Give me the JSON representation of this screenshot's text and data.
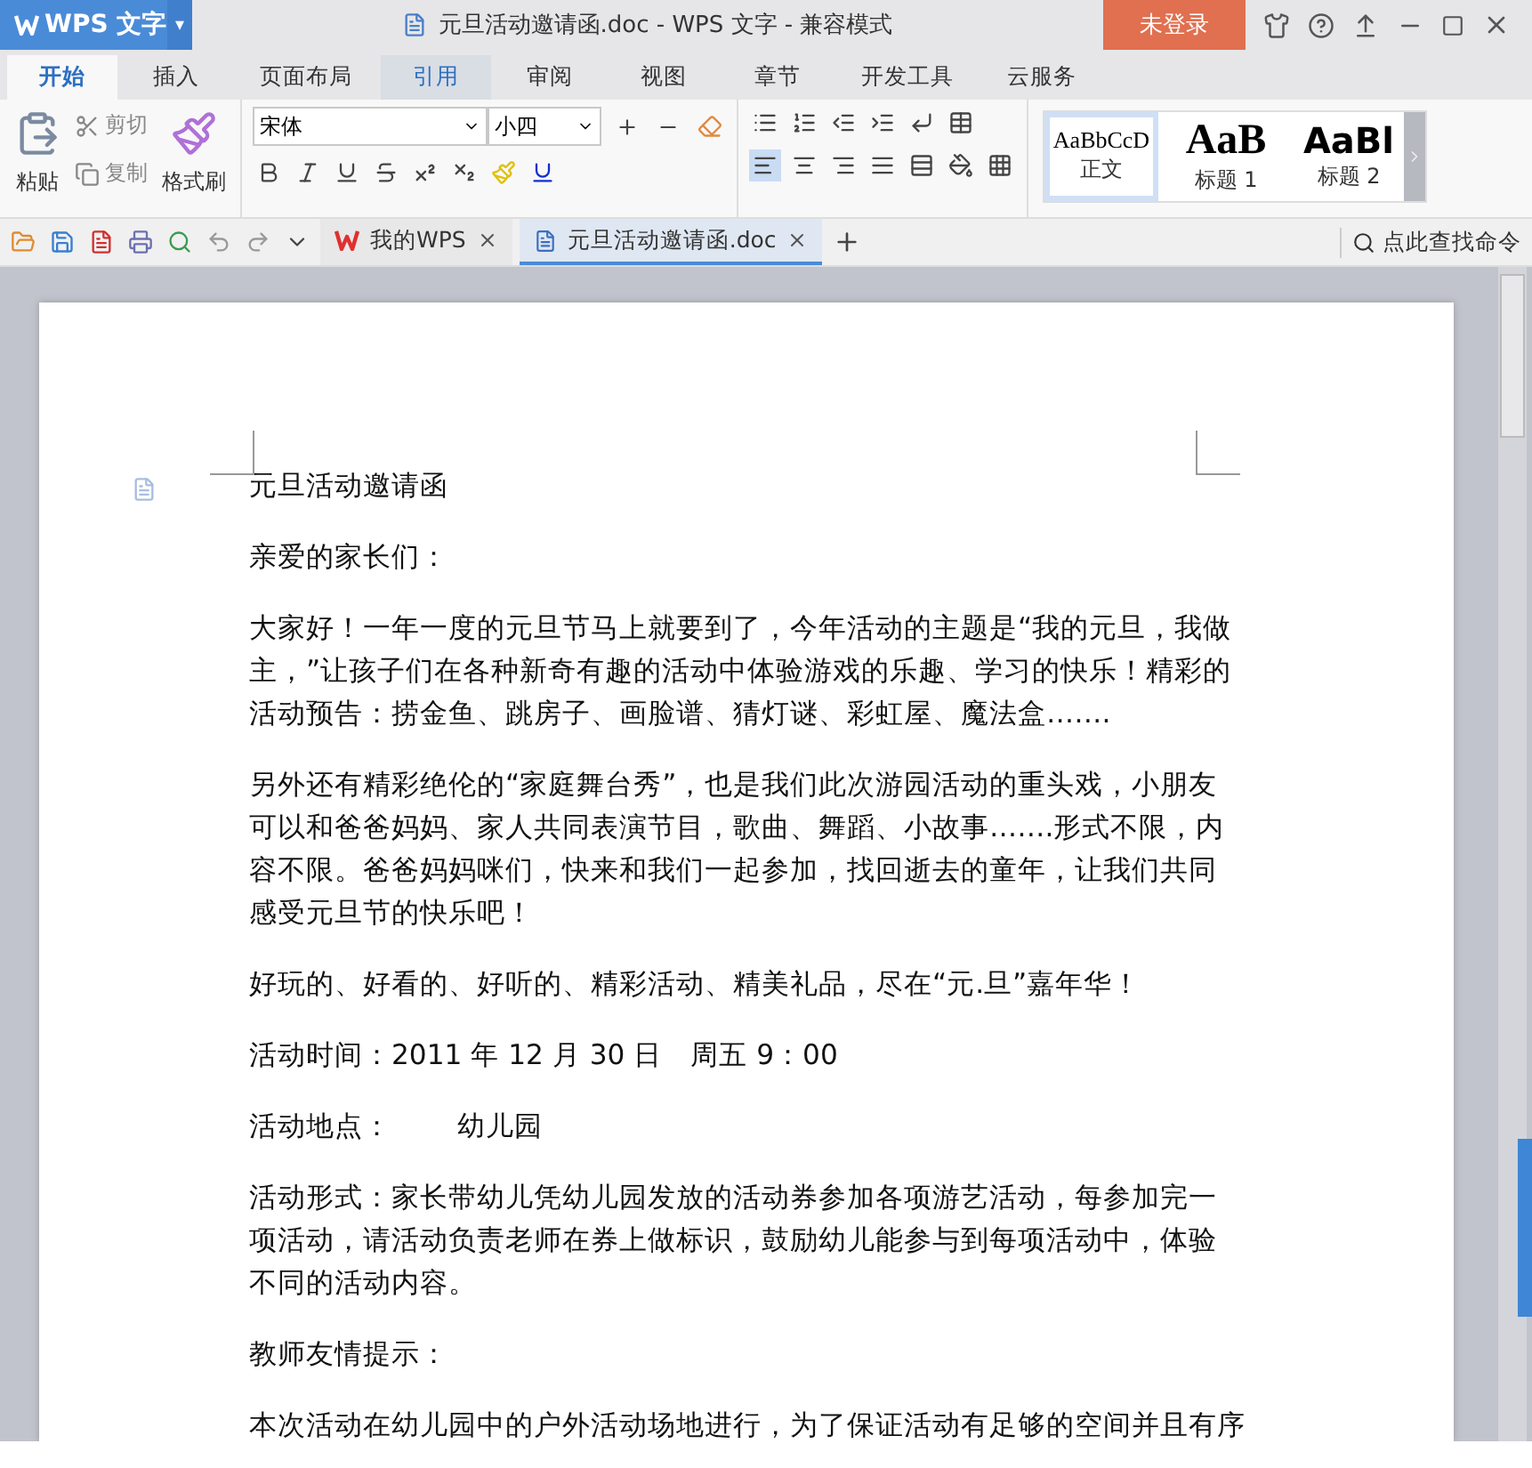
{
  "app_button": {
    "label": "WPS 文字",
    "caret": "▾"
  },
  "window": {
    "title": "元旦活动邀请函.doc - WPS 文字 - 兼容模式",
    "login": "未登录"
  },
  "tabs": [
    {
      "label": "开始",
      "selected": true
    },
    {
      "label": "插入",
      "selected": false
    },
    {
      "label": "页面布局",
      "selected": false
    },
    {
      "label": "引用",
      "selected": false,
      "hovered": true
    },
    {
      "label": "审阅",
      "selected": false
    },
    {
      "label": "视图",
      "selected": false
    },
    {
      "label": "章节",
      "selected": false
    },
    {
      "label": "开发工具",
      "selected": false
    },
    {
      "label": "云服务",
      "selected": false
    }
  ],
  "clipboard": {
    "paste": "粘贴",
    "cut": "剪切",
    "copy": "复制",
    "format_painter": "格式刷"
  },
  "font": {
    "name": "宋体",
    "size": "小四"
  },
  "styles": [
    {
      "preview": "AaBbCcD",
      "label": "正文",
      "selected": true,
      "kind": "normal"
    },
    {
      "preview": "AaB",
      "label": "标题 1",
      "selected": false,
      "kind": "h1"
    },
    {
      "preview": "AaBl",
      "label": "标题 2",
      "selected": false,
      "kind": "h2"
    }
  ],
  "doc_tabs": [
    {
      "label": "我的WPS",
      "kind": "home",
      "selected": false
    },
    {
      "label": "元旦活动邀请函.doc",
      "kind": "doc",
      "selected": true
    }
  ],
  "command_search": {
    "placeholder": "点此查找命令"
  },
  "document": {
    "paragraphs": [
      "元旦活动邀请函",
      "亲爱的家长们：",
      "大家好！一年一度的元旦节马上就要到了，今年活动的主题是“我的元旦，我做主，”让孩子们在各种新奇有趣的活动中体验游戏的乐趣、学习的快乐！精彩的活动预告：捞金鱼、跳房子、画脸谱、猜灯谜、彩虹屋、魔法盒…….",
      "另外还有精彩绝伦的“家庭舞台秀”，也是我们此次游园活动的重头戏，小朋友可以和爸爸妈妈、家人共同表演节目，歌曲、舞蹈、小故事…….形式不限，内容不限。爸爸妈妈咪们，快来和我们一起参加，找回逝去的童年，让我们共同感受元旦节的快乐吧！",
      "好玩的、好看的、好听的、精彩活动、精美礼品，尽在“元.旦”嘉年华！",
      "活动时间：2011 年 12 月 30 日　周五 9：00",
      "活动地点：　　 幼儿园",
      "活动形式：家长带幼儿凭幼儿园发放的活动券参加各项游艺活动，每参加完一项活动，请活动负责老师在券上做标识，鼓励幼儿能参与到每项活动中，体验不同的活动内容。",
      "教师友情提示："
    ],
    "cut_line": "本次活动在幼儿园中的户外活动场地进行，为了保证活动有足够的空间并且有序"
  }
}
